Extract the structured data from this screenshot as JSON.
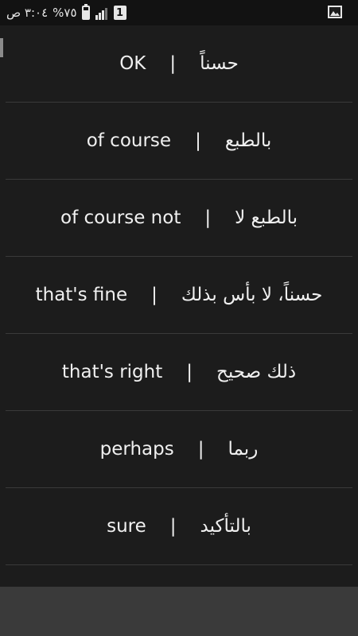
{
  "status_bar": {
    "time": "٣:٠٤ ص",
    "battery_percent": "%٧٥",
    "battery_level": 0.75,
    "notification_count": "1",
    "icons": [
      "battery-charging-icon",
      "signal-icon",
      "notification-icon",
      "gallery-icon"
    ]
  },
  "phrases": [
    {
      "english": "OK",
      "separator": "|",
      "arabic": "حسناً"
    },
    {
      "english": "of course",
      "separator": "|",
      "arabic": "بالطبع"
    },
    {
      "english": "of course not",
      "separator": "|",
      "arabic": "بالطبع لا"
    },
    {
      "english": "that's fine",
      "separator": "|",
      "arabic": "حسناً، لا بأس بذلك"
    },
    {
      "english": "that's right",
      "separator": "|",
      "arabic": "ذلك صحيح"
    },
    {
      "english": "perhaps",
      "separator": "|",
      "arabic": "ربما"
    },
    {
      "english": "sure",
      "separator": "|",
      "arabic": "بالتأكيد"
    }
  ],
  "colors": {
    "background": "#1c1c1c",
    "status_bar": "#121212",
    "text": "#f0f0f0",
    "divider": "#3a3a3a",
    "bottom_bar": "#3a3a3a"
  }
}
